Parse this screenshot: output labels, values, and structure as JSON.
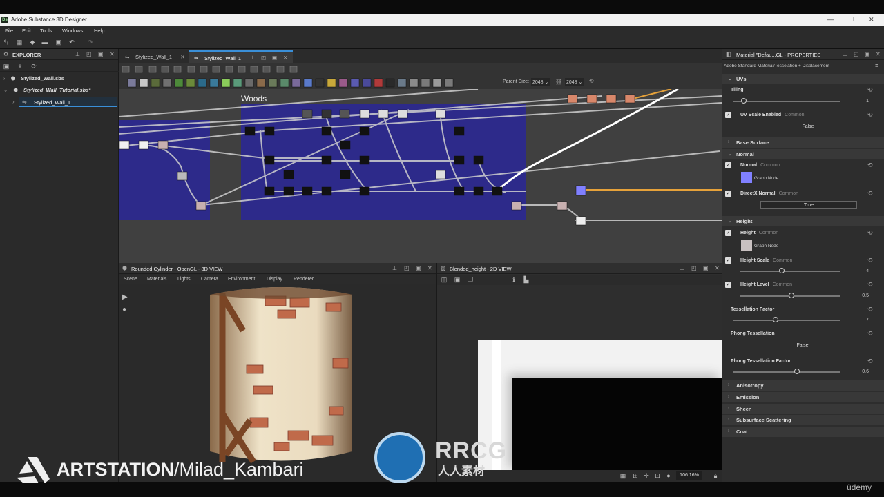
{
  "app": {
    "title": "Adobe Substance 3D Designer"
  },
  "menu": [
    "File",
    "Edit",
    "Tools",
    "Windows",
    "Help"
  ],
  "explorer": {
    "title": "EXPLORER",
    "packages": [
      {
        "label": "Stylized_Wall.sbs"
      },
      {
        "label": "Stylized_Wall_Tutorial.sbs*"
      }
    ],
    "graph_item": "Stylized_Wall_1"
  },
  "graph": {
    "tabs": [
      "Stylized_Wall_1",
      "Stylized_Wall_1"
    ],
    "parent_size_label": "Parent Size:",
    "parent_size_value": "2048",
    "size_value": "2048",
    "frame_label": "Woods"
  },
  "view3d": {
    "title": "Rounded Cylinder - OpenGL - 3D VIEW",
    "menu": [
      "Scene",
      "Materials",
      "Lights",
      "Camera",
      "Environment",
      "Display",
      "Renderer"
    ]
  },
  "view2d": {
    "title": "Blended_height - 2D VIEW",
    "zoom": "106.16%"
  },
  "properties": {
    "title": "Material \"Defau...GL - PROPERTIES",
    "subtitle": "Adobe Standard Material/Tesselation + Displacement",
    "uvs": {
      "section": "UVs",
      "tiling_label": "Tiling",
      "tiling_value": "1",
      "uv_scale_label": "UV Scale Enabled",
      "uv_scale_common": "Common",
      "uv_scale_value": "False"
    },
    "base_surface": "Base Surface",
    "normal": {
      "section": "Normal",
      "normal_label": "Normal",
      "normal_common": "Common",
      "normal_node": "Graph Node",
      "directx_label": "DirectX Normal",
      "directx_common": "Common",
      "directx_value": "True"
    },
    "height": {
      "section": "Height",
      "height_label": "Height",
      "height_common": "Common",
      "height_node": "Graph Node",
      "scale_label": "Height Scale",
      "scale_common": "Common",
      "scale_value": "4",
      "level_label": "Height Level",
      "level_common": "Common",
      "level_value": "0.5",
      "tess_label": "Tessellation Factor",
      "tess_value": "7",
      "phong_label": "Phong Tessellation",
      "phong_value": "False",
      "phong_factor_label": "Phong Tessellation Factor",
      "phong_factor_value": "0.6"
    },
    "collapsed_sections": [
      "Anisotropy",
      "Emission",
      "Sheen",
      "Subsurface Scattering",
      "Coat"
    ]
  },
  "watermark": {
    "artstation": "ARTSTATION",
    "artist": "/Milad_Kambari",
    "rrcg": "RRCG",
    "rrcg_sub": "人人素材",
    "udemy": "ûdemy"
  },
  "colors": {
    "frame_blue": "#2d2a8a",
    "accent": "#3a8fd8",
    "normal_swatch": "#8080ff"
  }
}
